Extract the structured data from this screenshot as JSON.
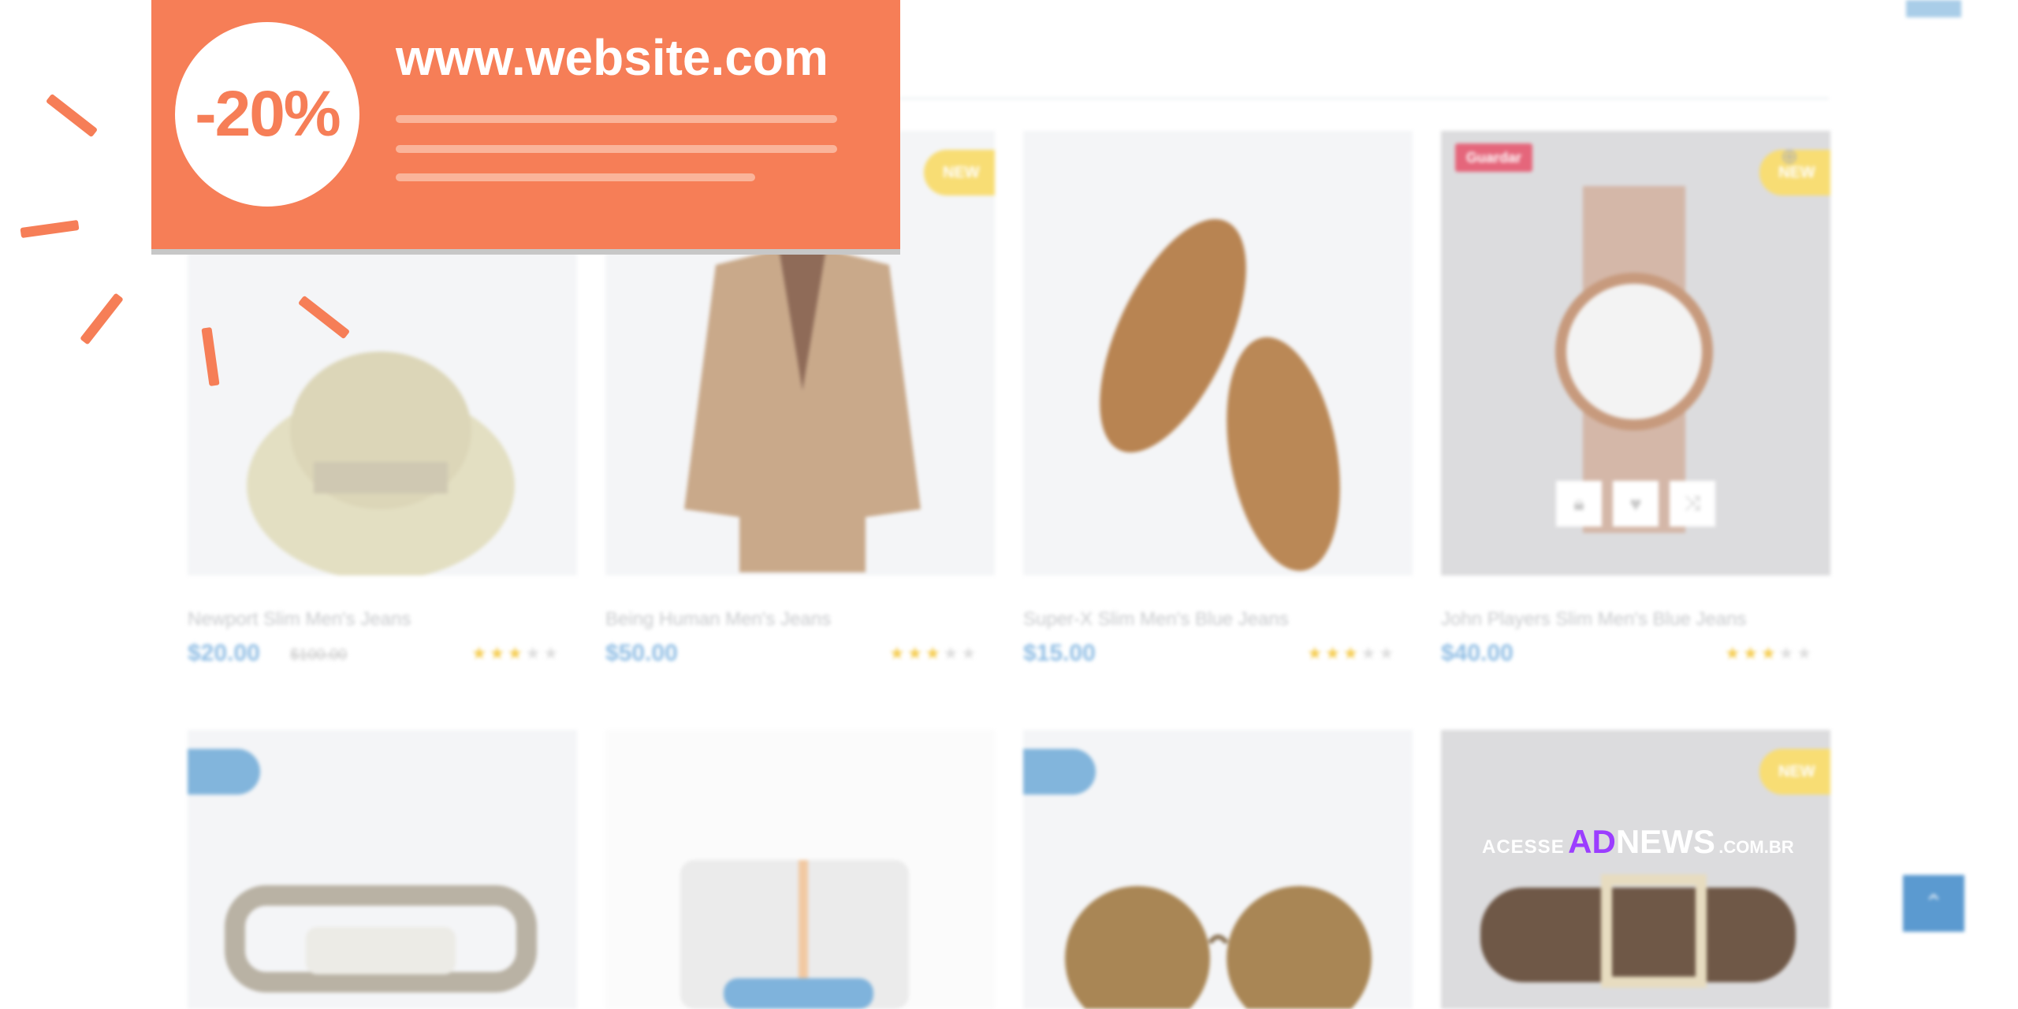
{
  "promo": {
    "discount": "-20%",
    "url": "www.website.com"
  },
  "watermark": {
    "prefix": "ACESSE",
    "brand_ad": "AD",
    "brand_news": "NEWS",
    "suffix": ".COM.BR"
  },
  "badges": {
    "new": "NEW",
    "guardar": "Guardar"
  },
  "products": [
    {
      "title": "Newport Slim Men's Jeans",
      "price": "$20.00",
      "old_price": "$100.00",
      "rating": 3
    },
    {
      "title": "Being Human Men's Jeans",
      "price": "$50.00",
      "rating": 3
    },
    {
      "title": "Super-X Slim Men's Blue Jeans",
      "price": "$15.00",
      "rating": 3
    },
    {
      "title": "John Players Slim Men's Blue Jeans",
      "price": "$40.00",
      "rating": 3
    }
  ],
  "colors": {
    "promo_accent": "#f67e57",
    "price_blue": "#8fbde4",
    "star_gold": "#f5cd53",
    "badge_new_yellow": "#f8dd74",
    "badge_sale_blue": "#82b5dc",
    "badge_red": "#e5667b",
    "scroll_button": "#5b9ad0"
  },
  "icons": [
    "cart-icon",
    "heart-icon",
    "shuffle-icon",
    "arrow-up-icon",
    "zoom-icon"
  ]
}
